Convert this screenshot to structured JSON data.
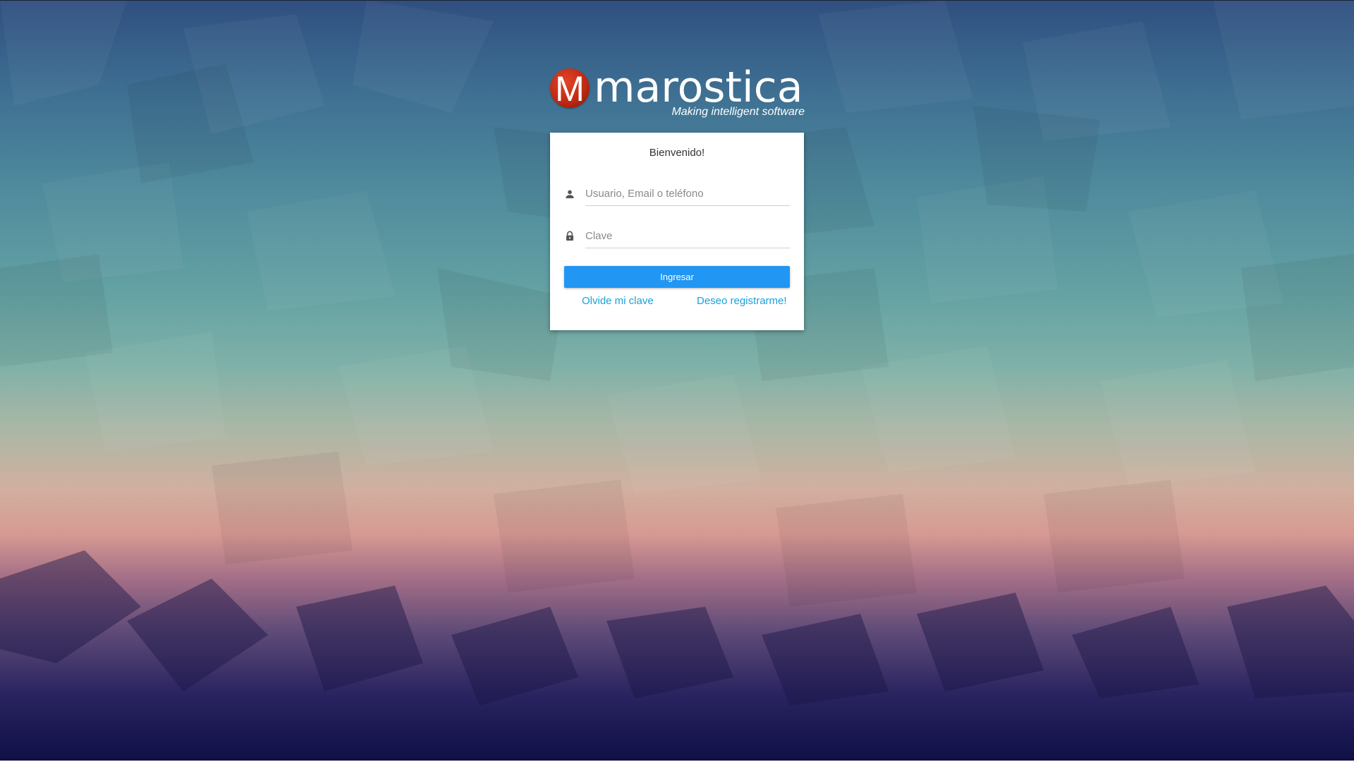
{
  "brand": {
    "logo_letter": "M",
    "name": "Marostica",
    "tagline": "Making intelligent software",
    "logo_color": "#c12a12"
  },
  "login": {
    "title": "Bienvenido!",
    "username": {
      "icon": "person-icon",
      "placeholder": "Usuario, Email o teléfono",
      "value": ""
    },
    "password": {
      "icon": "lock-icon",
      "placeholder": "Clave",
      "value": ""
    },
    "submit_label": "Ingresar",
    "forgot_label": "Olvide mi clave",
    "register_label": "Deseo registrarme!"
  },
  "colors": {
    "primary_button": "#2196f3",
    "link": "#1aa1d8"
  }
}
